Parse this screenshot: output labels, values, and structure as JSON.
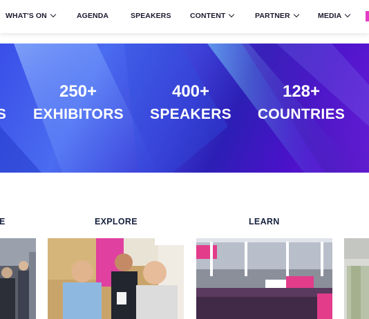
{
  "nav": {
    "items": [
      {
        "label": "WHAT'S ON",
        "dropdown": true
      },
      {
        "label": "AGENDA",
        "dropdown": false
      },
      {
        "label": "SPEAKERS",
        "dropdown": false
      },
      {
        "label": "CONTENT",
        "dropdown": true
      },
      {
        "label": "PARTNER",
        "dropdown": true
      },
      {
        "label": "MEDIA",
        "dropdown": true
      }
    ],
    "accent_color": "#e23cc8"
  },
  "hero": {
    "partial_label": "S",
    "stats": [
      {
        "number": "250+",
        "label": "EXHIBITORS"
      },
      {
        "number": "400+",
        "label": "SPEAKERS"
      },
      {
        "number": "128+",
        "label": "COUNTRIES"
      }
    ],
    "colors": {
      "start": "#3a4ee8",
      "end": "#6a18d8"
    }
  },
  "sections": [
    {
      "title": "E"
    },
    {
      "title": "EXPLORE"
    },
    {
      "title": "LEARN"
    }
  ],
  "images": [
    {
      "icon": "crowd-photo"
    },
    {
      "icon": "people-networking-photo"
    },
    {
      "icon": "conference-hall-photo"
    },
    {
      "icon": "person-photo"
    }
  ]
}
